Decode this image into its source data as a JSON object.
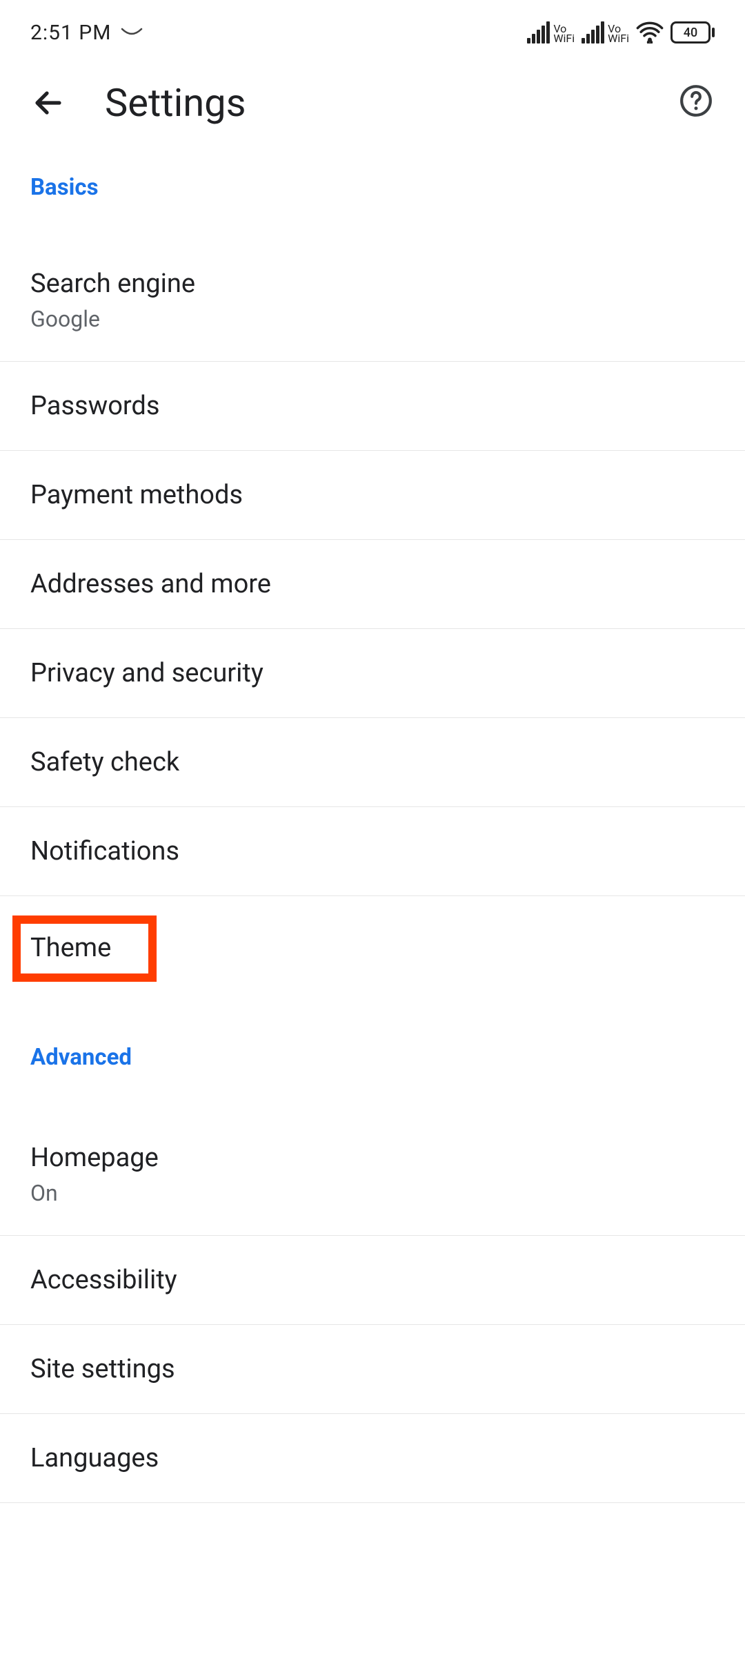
{
  "statusBar": {
    "time": "2:51 PM",
    "vowifi1": {
      "vo": "Vo",
      "wifi": "WiFi"
    },
    "vowifi2": {
      "vo": "Vo",
      "wifi": "WiFi"
    },
    "batteryLevel": "40"
  },
  "header": {
    "title": "Settings"
  },
  "sections": {
    "basics": {
      "label": "Basics",
      "items": {
        "searchEngine": {
          "title": "Search engine",
          "subtitle": "Google"
        },
        "passwords": {
          "title": "Passwords"
        },
        "paymentMethods": {
          "title": "Payment methods"
        },
        "addresses": {
          "title": "Addresses and more"
        },
        "privacy": {
          "title": "Privacy and security"
        },
        "safetyCheck": {
          "title": "Safety check"
        },
        "notifications": {
          "title": "Notifications"
        },
        "theme": {
          "title": "Theme"
        }
      }
    },
    "advanced": {
      "label": "Advanced",
      "items": {
        "homepage": {
          "title": "Homepage",
          "subtitle": "On"
        },
        "accessibility": {
          "title": "Accessibility"
        },
        "siteSettings": {
          "title": "Site settings"
        },
        "languages": {
          "title": "Languages"
        }
      }
    }
  },
  "highlight": {
    "color": "#ff3d00"
  }
}
